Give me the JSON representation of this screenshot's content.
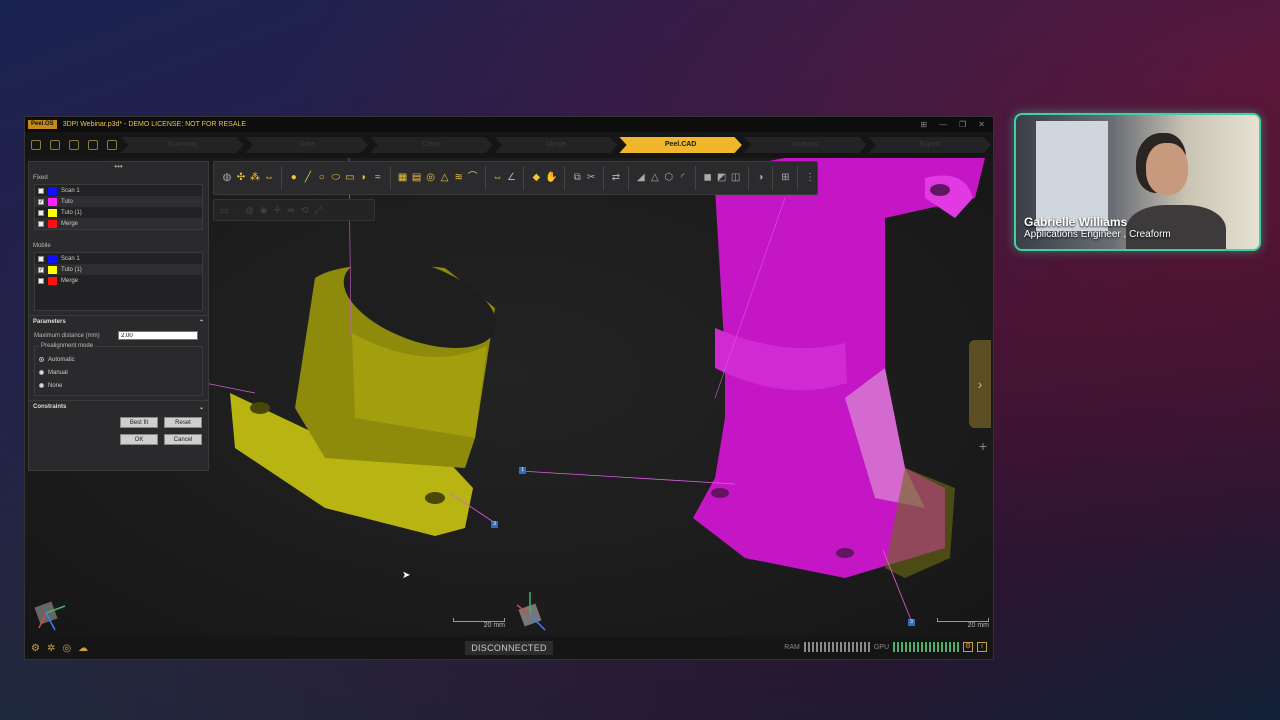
{
  "window": {
    "logo": "Peel.OS",
    "title": "3DPI Webinar.p3d* - DEMO LICENSE: NOT FOR RESALE"
  },
  "workflow": {
    "steps": [
      "Scanning",
      "Data",
      "Clean",
      "Merge",
      "Peel.CAD",
      "Analysis",
      "Export"
    ],
    "active": "Peel.CAD"
  },
  "panel": {
    "fixed_title": "Fixed",
    "fixed_items": [
      {
        "label": "Scan 1",
        "checked": false,
        "color": "#1010ff"
      },
      {
        "label": "Tuto",
        "checked": true,
        "color": "#ff20ff"
      },
      {
        "label": "Tuto (1)",
        "checked": false,
        "color": "#ffff00"
      },
      {
        "label": "Merge",
        "checked": false,
        "color": "#ff1010"
      }
    ],
    "mobile_title": "Mobile",
    "mobile_items": [
      {
        "label": "Scan 1",
        "checked": false,
        "color": "#1010ff"
      },
      {
        "label": "Tuto (1)",
        "checked": true,
        "color": "#ffff00"
      },
      {
        "label": "Merge",
        "checked": false,
        "color": "#ff1010"
      }
    ],
    "parameters_label": "Parameters",
    "max_distance_label": "Maximum distance (mm)",
    "max_distance_value": "2.00",
    "prealignment_label": "Prealignment mode",
    "modes": [
      "Automatic",
      "Manual",
      "None"
    ],
    "selected_mode": "Automatic",
    "constraints_label": "Constraints",
    "best_fit": "Best fit",
    "reset": "Reset",
    "ok": "OK",
    "cancel": "Cancel"
  },
  "viewport": {
    "scale_left": "20 mm",
    "scale_right": "20 mm",
    "points": [
      "1",
      "3",
      "3"
    ]
  },
  "status": {
    "connection": "DISCONNECTED",
    "ram_label": "RAM",
    "gpu_label": "GPU"
  },
  "webcam": {
    "name": "Gabrielle Williams",
    "role": "Applications Engineer , Creaform"
  }
}
